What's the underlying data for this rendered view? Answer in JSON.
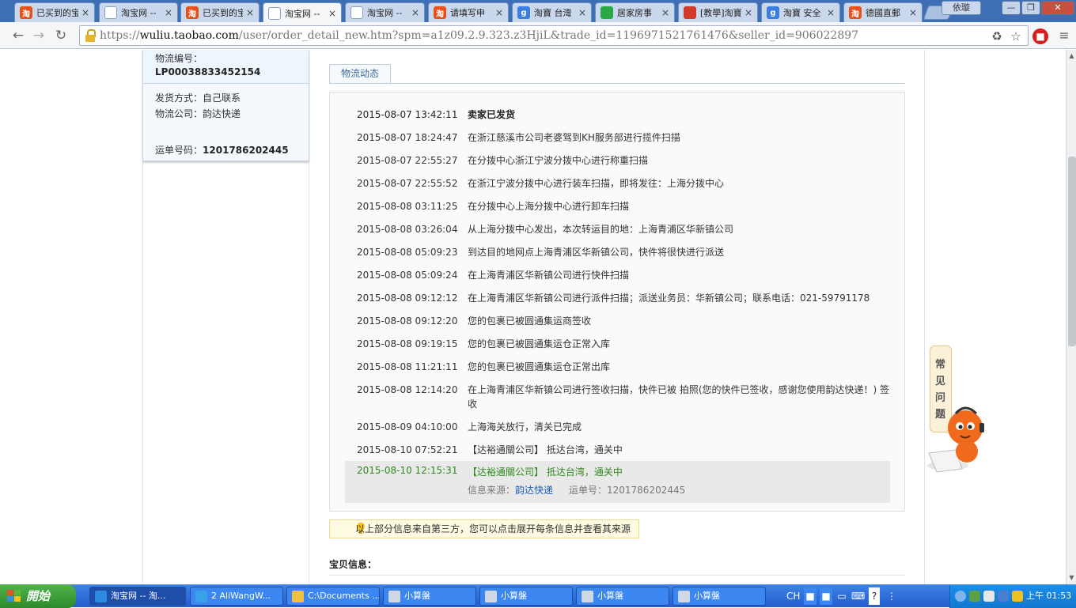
{
  "browser": {
    "tabs": [
      {
        "title": "已买到的宝",
        "icon": "taobao",
        "active": false
      },
      {
        "title": "淘宝网 --",
        "icon": "doc",
        "active": false
      },
      {
        "title": "已买到的宝",
        "icon": "taobao",
        "active": false
      },
      {
        "title": "淘宝网 --",
        "icon": "doc",
        "active": true
      },
      {
        "title": "淘宝网 --",
        "icon": "doc",
        "active": false
      },
      {
        "title": "请填写申",
        "icon": "taobao",
        "active": false
      },
      {
        "title": "淘寶 台灣",
        "icon": "google",
        "active": false
      },
      {
        "title": "居家房事",
        "icon": "green",
        "active": false
      },
      {
        "title": "[教學]淘寶",
        "icon": "red",
        "active": false
      },
      {
        "title": "淘寶 安全",
        "icon": "google",
        "active": false
      },
      {
        "title": "德國直郵",
        "icon": "taobao",
        "active": false
      }
    ],
    "user_badge": "依璇",
    "url_prefix": "https://",
    "url_host": "wuliu.taobao.com",
    "url_rest": "/user/order_detail_new.htm?spm=a1z09.2.9.323.z3HjiL&trade_id=1196971521761476&seller_id=906022897"
  },
  "left_panel": {
    "logistics_no_label": "物流编号：",
    "logistics_no": "LP00038833452154",
    "ship_method": "发货方式：自己联系",
    "ship_company": "物流公司：韵达快递",
    "waybill_label": "运单号码：",
    "waybill_no": "1201786202445"
  },
  "log_tab": "物流动态",
  "log_entries": [
    {
      "time": "2015-08-07 13:42:11",
      "msg": "卖家已发货"
    },
    {
      "time": "2015-08-07 18:24:47",
      "msg": "在浙江慈溪市公司老婆驾到KH服务部进行揽件扫描"
    },
    {
      "time": "2015-08-07 22:55:27",
      "msg": "在分拨中心浙江宁波分拨中心进行称重扫描"
    },
    {
      "time": "2015-08-07 22:55:52",
      "msg": "在浙江宁波分拨中心进行装车扫描，即将发往：上海分拨中心"
    },
    {
      "time": "2015-08-08 03:11:25",
      "msg": "在分拨中心上海分拨中心进行卸车扫描"
    },
    {
      "time": "2015-08-08 03:26:04",
      "msg": "从上海分拨中心发出，本次转运目的地：上海青浦区华新镇公司"
    },
    {
      "time": "2015-08-08 05:09:23",
      "msg": "到达目的地网点上海青浦区华新镇公司，快件将很快进行派送"
    },
    {
      "time": "2015-08-08 05:09:24",
      "msg": "在上海青浦区华新镇公司进行快件扫描"
    },
    {
      "time": "2015-08-08 09:12:12",
      "msg": "在上海青浦区华新镇公司进行派件扫描；派送业务员：华新镇公司；联系电话：021-59791178"
    },
    {
      "time": "2015-08-08 09:12:20",
      "msg": "您的包裹已被圆通集运商签收"
    },
    {
      "time": "2015-08-08 09:19:15",
      "msg": "您的包裹已被圆通集运仓正常入库"
    },
    {
      "time": "2015-08-08 11:21:11",
      "msg": "您的包裹已被圆通集运仓正常出库"
    },
    {
      "time": "2015-08-08 12:14:20",
      "msg": "在上海青浦区华新镇公司进行签收扫描，快件已被 拍照(您的快件已签收，感谢您使用韵达快递！) 签收"
    },
    {
      "time": "2015-08-09 04:10:00",
      "msg": "上海海关放行，清关已完成"
    },
    {
      "time": "2015-08-10 07:52:21",
      "msg": "【达裕通關公司】 抵达台湾，通关中"
    }
  ],
  "log_last": {
    "time": "2015-08-10 12:15:31",
    "msg": "【达裕通關公司】 抵达台湾，通关中",
    "source_label": "信息来源：",
    "source_link": "韵达快递",
    "waybill": "运单号：1201786202445"
  },
  "notice": "以上部分信息来自第三方，您可以点击展开每条信息并查看其来源",
  "item_title": "宝贝信息：",
  "faq": [
    "常",
    "见",
    "问",
    "题"
  ],
  "taskbar": {
    "start": "開始",
    "tasks": [
      {
        "label": "淘宝网 -- 淘...",
        "active": true
      },
      {
        "label": "2 AliWangW...",
        "active": false
      },
      {
        "label": "C:\\Documents ...",
        "active": false
      },
      {
        "label": "小算盤",
        "active": false
      },
      {
        "label": "小算盤",
        "active": false
      },
      {
        "label": "小算盤",
        "active": false
      },
      {
        "label": "小算盤",
        "active": false
      }
    ],
    "ime": "CH",
    "clock": "上午 01:53"
  }
}
